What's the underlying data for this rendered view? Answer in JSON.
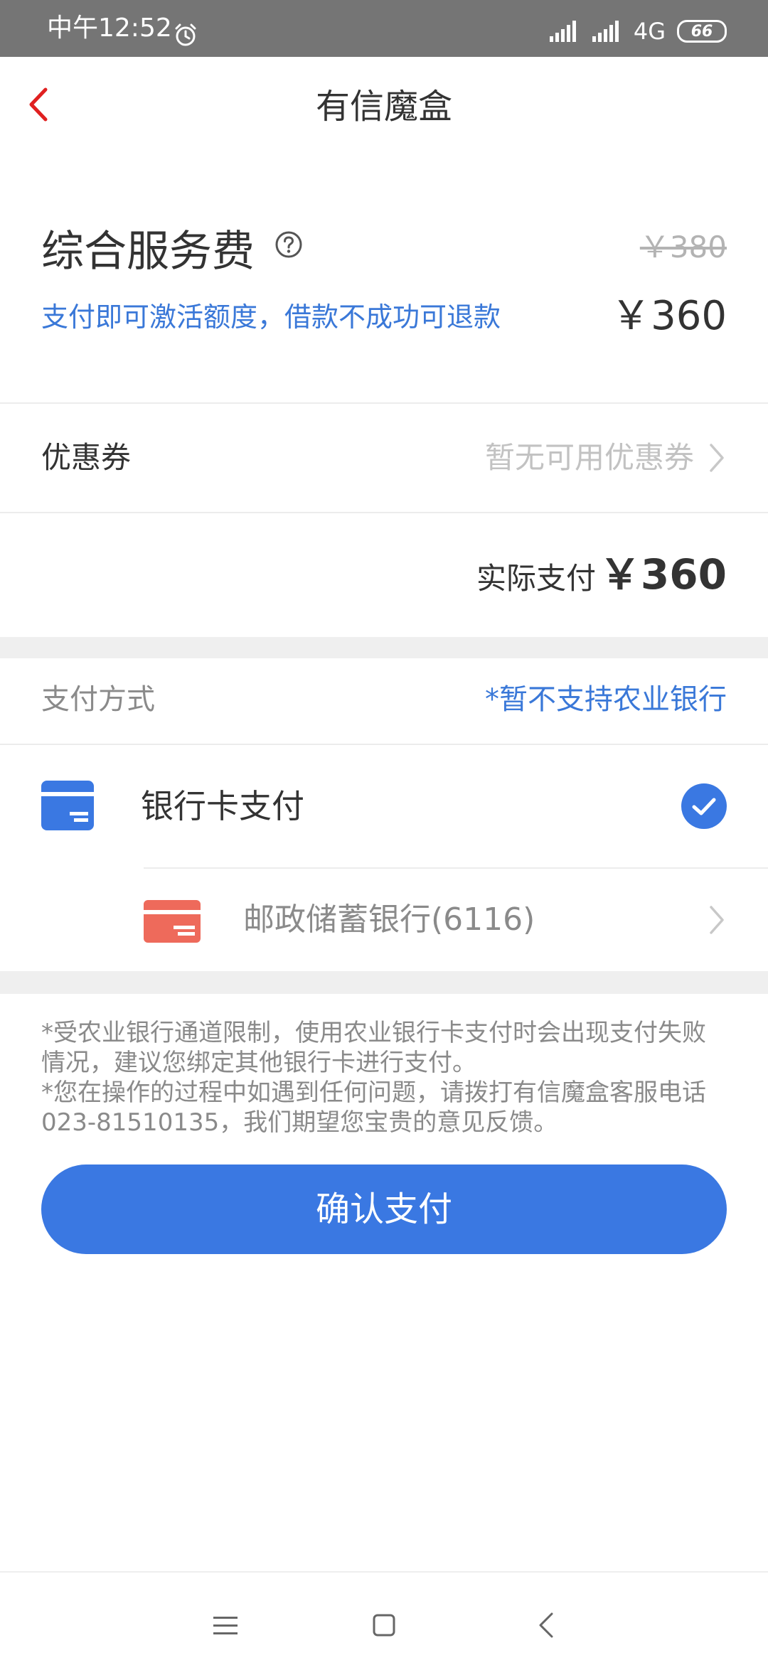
{
  "status_bar": {
    "time": "中午12:52",
    "network": "4G",
    "battery": "66"
  },
  "header": {
    "title": "有信魔盒"
  },
  "fee": {
    "title": "综合服务费",
    "original_price": "￥380",
    "subtitle": "支付即可激活额度，借款不成功可退款",
    "price": "￥360"
  },
  "coupon": {
    "label": "优惠券",
    "value": "暂无可用优惠券"
  },
  "actual_payment": {
    "label": "实际支付",
    "amount": "￥360"
  },
  "payment_method": {
    "label": "支付方式",
    "note": "*暂不支持农业银行",
    "bank_card_option": "银行卡支付",
    "bank_card_selected": true,
    "card": "邮政储蓄银行(6116)"
  },
  "notes": [
    "*受农业银行通道限制，使用农业银行卡支付时会出现支付失败情况，建议您绑定其他银行卡进行支付。",
    "*您在操作的过程中如遇到任何问题，请拨打有信魔盒客服电话023-81510135，我们期望您宝贵的意见反馈。"
  ],
  "confirm_button": "确认支付",
  "colors": {
    "accent_blue": "#3a78e2",
    "back_red": "#e02020",
    "card_red": "#ee6a5b",
    "status_bar": "#757575"
  },
  "icons": {
    "back": "chevron-left-icon",
    "help": "question-circle-icon",
    "chevron": "chevron-right-icon",
    "bank_card": "bank-card-icon",
    "check": "check-circle-icon",
    "nav_menu": "menu-icon",
    "nav_home": "home-square-icon",
    "nav_back": "back-triangle-icon"
  }
}
